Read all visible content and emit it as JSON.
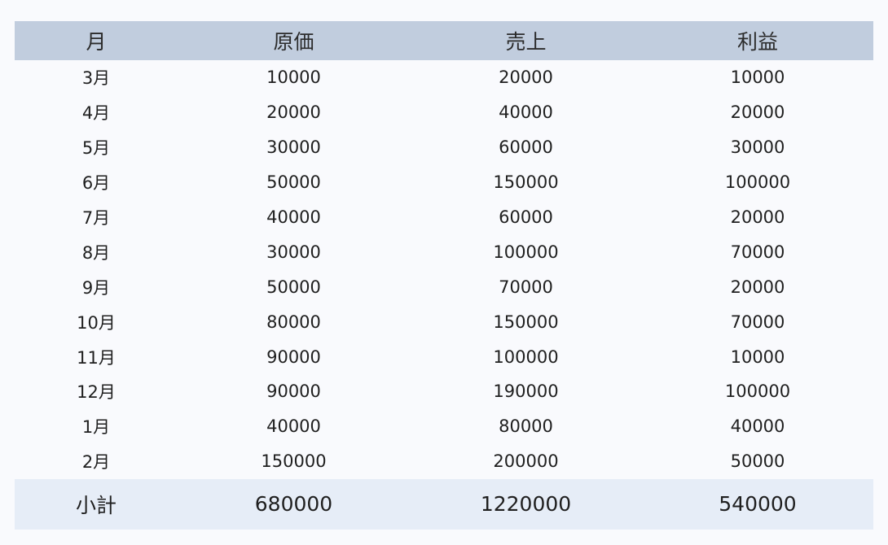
{
  "table": {
    "headers": {
      "month": "月",
      "cost": "原価",
      "sales": "売上",
      "profit": "利益"
    },
    "rows": [
      {
        "month": "3月",
        "cost": "10000",
        "sales": "20000",
        "profit": "10000"
      },
      {
        "month": "4月",
        "cost": "20000",
        "sales": "40000",
        "profit": "20000"
      },
      {
        "month": "5月",
        "cost": "30000",
        "sales": "60000",
        "profit": "30000"
      },
      {
        "month": "6月",
        "cost": "50000",
        "sales": "150000",
        "profit": "100000"
      },
      {
        "month": "7月",
        "cost": "40000",
        "sales": "60000",
        "profit": "20000"
      },
      {
        "month": "8月",
        "cost": "30000",
        "sales": "100000",
        "profit": "70000"
      },
      {
        "month": "9月",
        "cost": "50000",
        "sales": "70000",
        "profit": "20000"
      },
      {
        "month": "10月",
        "cost": "80000",
        "sales": "150000",
        "profit": "70000"
      },
      {
        "month": "11月",
        "cost": "90000",
        "sales": "100000",
        "profit": "10000"
      },
      {
        "month": "12月",
        "cost": "90000",
        "sales": "190000",
        "profit": "100000"
      },
      {
        "month": "1月",
        "cost": "40000",
        "sales": "80000",
        "profit": "40000"
      },
      {
        "month": "2月",
        "cost": "150000",
        "sales": "200000",
        "profit": "50000"
      }
    ],
    "subtotal": {
      "label": "小計",
      "cost": "680000",
      "sales": "1220000",
      "profit": "540000"
    }
  },
  "colors": {
    "header_bg": "#c1cdde",
    "footer_bg": "#e6edf7",
    "page_bg": "#f9fafd"
  }
}
